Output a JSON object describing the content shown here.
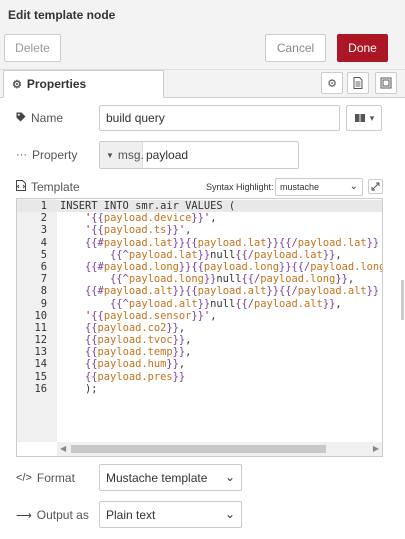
{
  "header": {
    "title": "Edit template node",
    "delete_label": "Delete",
    "cancel_label": "Cancel",
    "done_label": "Done"
  },
  "tabs": {
    "properties_label": "Properties",
    "icons": [
      "gear-icon",
      "description-icon",
      "appearance-icon"
    ]
  },
  "form": {
    "name_label": "Name",
    "name_value": "build query",
    "property_label": "Property",
    "property_type": "msg.",
    "property_value": "payload",
    "template_label": "Template",
    "syntax_label": "Syntax Highlight:",
    "syntax_value": "mustache",
    "format_label": "Format",
    "format_value": "Mustache template",
    "output_label": "Output as",
    "output_value": "Plain text"
  },
  "editor": {
    "line_numbers": [
      "1",
      "2",
      "3",
      "4",
      "5",
      "6",
      "7",
      "8",
      "9",
      "10",
      "11",
      "12",
      "13",
      "14",
      "15",
      "16"
    ],
    "lines": [
      "INSERT INTO smr.air VALUES (",
      "    '{{payload.device}}',",
      "    '{{payload.ts}}',",
      "    {{#payload.lat}}{{payload.lat}}{{/payload.lat}}",
      "        {{^payload.lat}}null{{/payload.lat}},",
      "    {{#payload.long}}{{payload.long}}{{/payload.long}}",
      "        {{^payload.long}}null{{/payload.long}},",
      "    {{#payload.alt}}{{payload.alt}}{{/payload.alt}}",
      "        {{^payload.alt}}null{{/payload.alt}},",
      "    '{{payload.sensor}}',",
      "    {{payload.co2}},",
      "    {{payload.tvoc}},",
      "    {{payload.temp}},",
      "    {{payload.hum}},",
      "    {{payload.pres}}",
      "    );"
    ],
    "active_line": 0
  },
  "colors": {
    "accent": "#ad1625",
    "string": "#a31515",
    "mustache_tag": "#7a3e9d",
    "variable": "#c5731e"
  }
}
